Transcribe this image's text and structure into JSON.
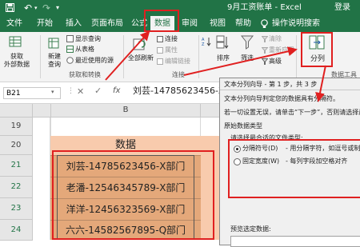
{
  "window": {
    "title": "9月工资账单 - Excel",
    "login": "登录",
    "colors": {
      "brand": "#217346",
      "annotation": "#e02020",
      "cell_fill": "#f8cbad",
      "data_cell": "#e4a87a"
    }
  },
  "quick_access": {
    "save_icon": "save-icon",
    "undo_icon": "undo-icon",
    "redo_icon": "redo-icon"
  },
  "tabs": [
    "文件",
    "开始",
    "插入",
    "页面布局",
    "公式",
    "数据",
    "审阅",
    "视图",
    "帮助"
  ],
  "active_tab": "数据",
  "tell_me": "操作说明搜索",
  "ribbon": {
    "get_external": "获取\n外部数据",
    "new_query": "新建\n查询",
    "show_query": "显示查询",
    "from_table": "从表格",
    "recent_sources": "最近使用的源",
    "group_get_transform": "获取和转换",
    "refresh_all": "全部刷新",
    "connections": "连接",
    "properties": "属性",
    "edit_links": "编辑链接",
    "group_connections": "连接",
    "sort_label": "排序",
    "filter_label": "筛选",
    "clear_label": "清除",
    "reapply_label": "重新应用",
    "advanced_label": "高级",
    "split_label": "分列",
    "group_tools": "数据工具"
  },
  "formula_bar": {
    "name_box": "B21",
    "fx": "fx",
    "content": "刘芸-14785623456-X部门"
  },
  "sheet": {
    "column_header": "B",
    "rows": [
      {
        "n": "19",
        "text": ""
      },
      {
        "n": "20",
        "text": "数据"
      },
      {
        "n": "21",
        "text": "刘芸-14785623456-X部门"
      },
      {
        "n": "22",
        "text": "老潘-12546345789-X部门"
      },
      {
        "n": "23",
        "text": "洋洋-12456323569-X部门"
      },
      {
        "n": "24",
        "text": "六六-14582567895-Q部门"
      },
      {
        "n": "25",
        "text": ""
      }
    ]
  },
  "dialog": {
    "title": "文本分列向导 - 第 1 步，共 3 步",
    "line1": "文本分列向导判定您的数据具有分隔符。",
    "line2": "若一切设置无误，请单击“下一步”，否则请选择最",
    "section": "原始数据类型",
    "prompt": "请选择最合适的文件类型:",
    "option1": "分隔符号(D)",
    "option1_desc": "- 用分隔字符，如逗号或制",
    "option2": "固定宽度(W)",
    "option2_desc": "- 每列字段加空格对齐",
    "preview": "预览选定数据:",
    "selected_option": 1
  }
}
